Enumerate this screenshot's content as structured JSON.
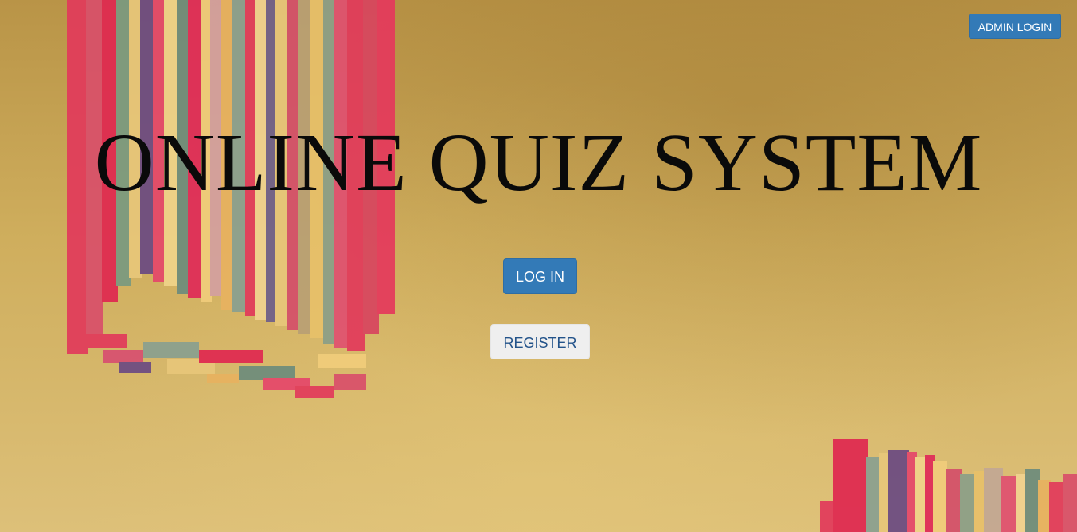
{
  "header": {
    "admin_login_label": "ADMIN LOGIN"
  },
  "main": {
    "title": "ONLINE QUIZ SYSTEM",
    "login_label": "LOG IN",
    "register_label": "REGISTER"
  },
  "colors": {
    "primary_button": "#337ab7",
    "secondary_button": "#efefef",
    "background": "#cfae5d"
  }
}
